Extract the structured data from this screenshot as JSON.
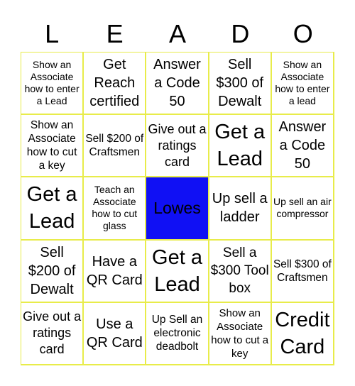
{
  "header": {
    "letters": [
      "L",
      "E",
      "A",
      "D",
      "O"
    ]
  },
  "board": {
    "grid_color": "#e8ec4a",
    "free_space_color": "#1010f4",
    "rows": [
      [
        "Show an Associate how to enter a Lead",
        "Get Reach certified",
        "Answer a Code 50",
        "Sell $300 of Dewalt",
        "Show an Associate how to enter a lead"
      ],
      [
        "Show an Associate how to cut a key",
        "Sell $200 of Craftsmen",
        "Give out a ratings card",
        "Get a Lead",
        "Answer a Code 50"
      ],
      [
        "Get a Lead",
        "Teach an Associate how to cut glass",
        "Lowes",
        "Up sell a ladder",
        "Up sell an air compressor"
      ],
      [
        "Sell $200 of Dewalt",
        "Have a QR Card",
        "Get a Lead",
        "Sell a $300 Tool box",
        "Sell $300 of Craftsmen"
      ],
      [
        "Give out a ratings card",
        "Use a QR Card",
        "Up Sell an electronic deadbolt",
        "Show an Associate how to cut a key",
        "Credit Card"
      ]
    ],
    "free_space": {
      "row": 2,
      "col": 2,
      "label": "Lowes"
    }
  }
}
